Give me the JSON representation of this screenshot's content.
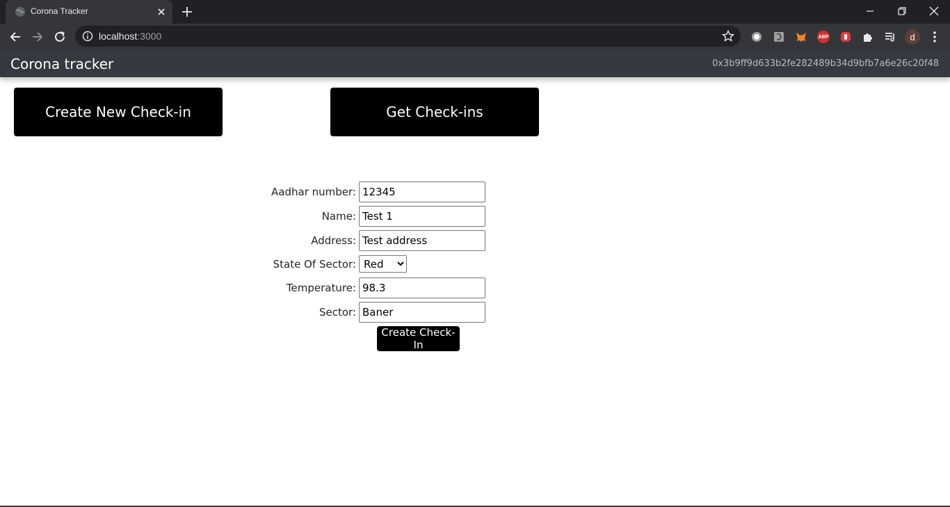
{
  "browser": {
    "tab_title": "Corona Tracker",
    "url_host": "localhost",
    "url_port": ":3000",
    "extensions": [
      "record-icon",
      "puzzle-grey-icon",
      "metamask-icon",
      "abp-icon",
      "hand-stop-icon",
      "extensions-icon",
      "playlist-icon"
    ],
    "abp_label": "ABP",
    "profile_initial": "d"
  },
  "navbar": {
    "brand": "Corona tracker",
    "account": "0x3b9ff9d633b2fe282489b34d9bfb7a6e26c20f48"
  },
  "actions": {
    "create_new": "Create New Check-in",
    "get_checkins": "Get Check-ins"
  },
  "form": {
    "aadhar_label": "Aadhar number:",
    "aadhar_value": "12345",
    "name_label": "Name:",
    "name_value": "Test 1",
    "address_label": "Address:",
    "address_value": "Test address",
    "state_label": "State Of Sector:",
    "state_value": "Red",
    "temperature_label": "Temperature:",
    "temperature_value": "98.3",
    "sector_label": "Sector:",
    "sector_value": "Baner",
    "submit_label": "Create Check-In"
  },
  "colors": {
    "navbar_bg": "#343a40",
    "button_bg": "#000000",
    "chrome_dark": "#202124",
    "chrome_toolbar": "#35363a"
  }
}
